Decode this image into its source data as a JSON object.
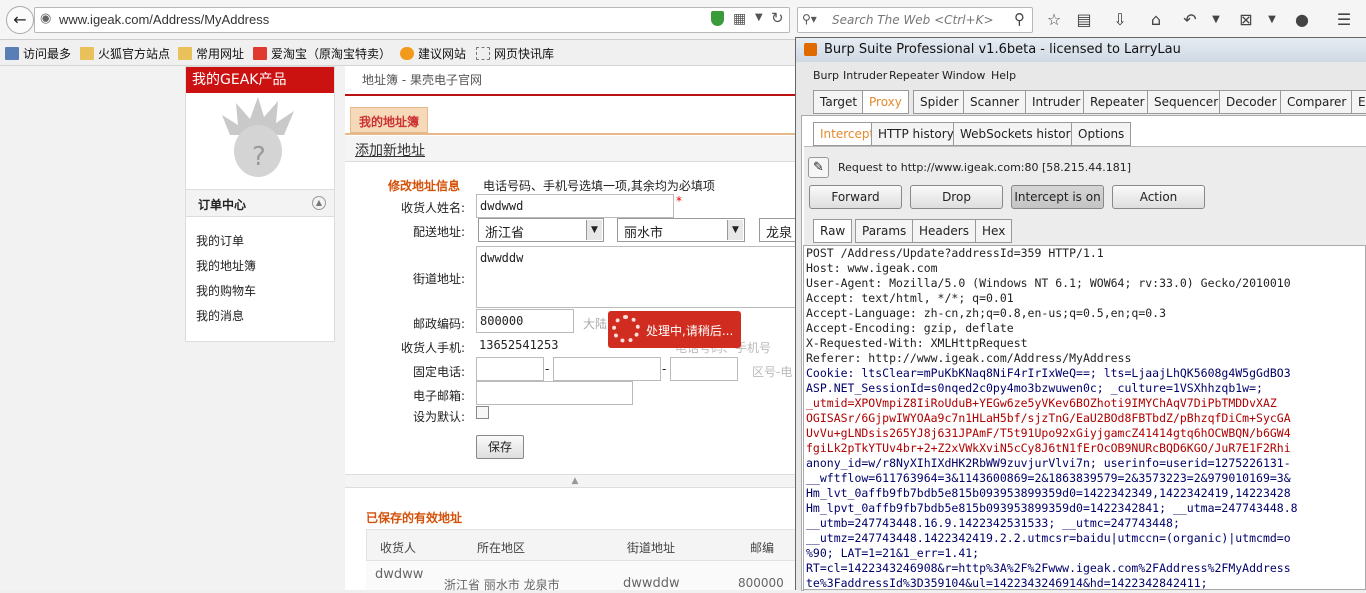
{
  "browser": {
    "url": "www.igeak.com/Address/MyAddress",
    "search_placeholder": "Search The Web <Ctrl+K>",
    "bookmarks": [
      "访问最多",
      "火狐官方站点",
      "常用网址",
      "爱淘宝（原淘宝特卖）",
      "建议网站",
      "网页快讯库"
    ]
  },
  "sidebar": {
    "title": "我的GEAK产品",
    "section": "订单中心",
    "items": [
      "我的订单",
      "我的地址簿",
      "我的购物车",
      "我的消息"
    ]
  },
  "main": {
    "breadcrumb": "地址簿 - 果壳电子官网",
    "tab": "我的地址簿",
    "heading": "添加新地址",
    "form_title": "修改地址信息",
    "form_note": "电话号码、手机号选填一项,其余均为必填项",
    "labels": {
      "name": "收货人姓名:",
      "region": "配送地址:",
      "street": "街道地址:",
      "zip": "邮政编码:",
      "mobile": "收货人手机:",
      "phone": "固定电话:",
      "email": "电子邮箱:",
      "default": "设为默认:"
    },
    "values": {
      "name": "dwdwwd",
      "province": "浙江省",
      "city": "丽水市",
      "district": "龙泉",
      "street": "dwwddw",
      "zip": "800000",
      "zip_hint": "大陆",
      "mobile": "13652541253",
      "mobile_hint": "电话号码、手机号",
      "phone_hint": "区号-电"
    },
    "save": "保存",
    "loading": "处理中,请稍后...",
    "saved_title": "已保存的有效地址",
    "table_headers": [
      "收货人",
      "所在地区",
      "街道地址",
      "邮编"
    ],
    "table_row": [
      "dwdww",
      "浙江省 丽水市 龙泉市",
      "dwwddw",
      "800000"
    ]
  },
  "burp": {
    "title": "Burp Suite Professional v1.6beta - licensed to LarryLau",
    "menu": [
      "Burp",
      "Intruder",
      "Repeater",
      "Window",
      "Help"
    ],
    "tabs": [
      "Target",
      "Proxy",
      "Spider",
      "Scanner",
      "Intruder",
      "Repeater",
      "Sequencer",
      "Decoder",
      "Comparer",
      "Ex"
    ],
    "subtabs": [
      "Intercept",
      "HTTP history",
      "WebSockets history",
      "Options"
    ],
    "request_info": "Request to http://www.igeak.com:80  [58.215.44.181]",
    "buttons": [
      "Forward",
      "Drop",
      "Intercept is on",
      "Action"
    ],
    "view_tabs": [
      "Raw",
      "Params",
      "Headers",
      "Hex"
    ],
    "request_lines": [
      {
        "t": "POST /Address/Update?addressId=359 HTTP/1.1",
        "c": ""
      },
      {
        "t": "Host: www.igeak.com",
        "c": ""
      },
      {
        "t": "User-Agent: Mozilla/5.0 (Windows NT 6.1; WOW64; rv:33.0) Gecko/2010010",
        "c": ""
      },
      {
        "t": "Accept: text/html, */*; q=0.01",
        "c": ""
      },
      {
        "t": "Accept-Language: zh-cn,zh;q=0.8,en-us;q=0.5,en;q=0.3",
        "c": ""
      },
      {
        "t": "Accept-Encoding: gzip, deflate",
        "c": ""
      },
      {
        "t": "X-Requested-With: XMLHttpRequest",
        "c": ""
      },
      {
        "t": "Referer: http://www.igeak.com/Address/MyAddress",
        "c": ""
      },
      {
        "t": "Cookie: ltsClear=mPuKbKNaq8NiF4rIrIxWeQ==; lts=LjaajLhQK5608g4W5gGdBO3",
        "c": "blue"
      },
      {
        "t": "ASP.NET_SessionId=s0nqed2c0py4mo3bzwuwen0c; _culture=1VSXhhzqb1w=;",
        "c": "blue"
      },
      {
        "t": "_utmid=XPOVmpiZ8IiRoUduB+YEGw6ze5yVKev6BOZhoti9IMYChAqV7DiPbTMDDvXAZ",
        "c": "red"
      },
      {
        "t": "OGISASr/6GjpwIWYOAa9c7n1HLaH5bf/sjzTnG/EaU2BOd8FBTbdZ/pBhzqfDiCm+SycGA",
        "c": "red"
      },
      {
        "t": "UvVu+gLNDsis265YJ8j631JPAmF/T5t91Upo92xGiyjgamcZ41414gtq6hOCWBQN/b6GW4",
        "c": "red"
      },
      {
        "t": "fgiLk2pTkYTUv4br+2+Z2xVWkXviN5cCy8J6tN1fErOcOB9NURcBQD6KGO/JuR7E1F2Rhi",
        "c": "red"
      },
      {
        "t": "anony_id=w/r8NyXIhIXdHK2RbWW9zuvjurVlvi7n; userinfo=userid=1275226131-",
        "c": "blue"
      },
      {
        "t": "__wftflow=611763964=3&1143600869=2&1863839579=2&3573223=2&979010169=3&",
        "c": "blue"
      },
      {
        "t": "Hm_lvt_0affb9fb7bdb5e815b093953899359d0=1422342349,1422342419,14223428",
        "c": "blue"
      },
      {
        "t": "Hm_lpvt_0affb9fb7bdb5e815b093953899359d0=1422342841; __utma=247743448.8",
        "c": "blue"
      },
      {
        "t": "__utmb=247743448.16.9.1422342531533; __utmc=247743448;",
        "c": "blue"
      },
      {
        "t": "__utmz=247743448.1422342419.2.2.utmcsr=baidu|utmccn=(organic)|utmcmd=o",
        "c": "blue"
      },
      {
        "t": "%90; LAT=1=21&1_err=1.41;",
        "c": "blue"
      },
      {
        "t": "RT=cl=1422343246908&r=http%3A%2F%2Fwww.igeak.com%2FAddress%2FMyAddress",
        "c": "blue"
      },
      {
        "t": "te%3FaddressId%3D359104&ul=1422343246914&hd=1422342842411;",
        "c": "blue"
      }
    ]
  }
}
